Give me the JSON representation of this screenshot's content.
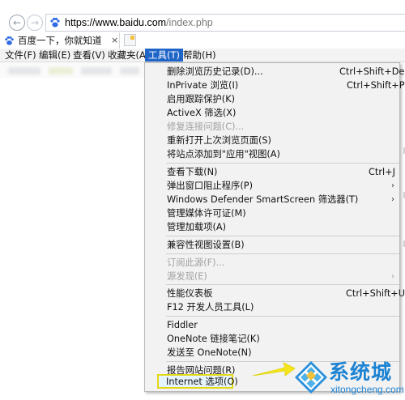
{
  "address_bar": {
    "url_main": "https://www.baidu.com",
    "url_path": "/index.php"
  },
  "tab": {
    "title": "百度一下，你就知道",
    "close_glyph": "×"
  },
  "menu_bar": {
    "items": [
      "文件(F)",
      "编辑(E)",
      "查看(V)",
      "收藏夹(A)",
      "工具(T)",
      "帮助(H)"
    ],
    "active_item": "工具(T)"
  },
  "tools_menu": {
    "items": [
      {
        "label": "删除浏览历史记录(D)...",
        "shortcut": "Ctrl+Shift+Del"
      },
      {
        "label": "InPrivate 浏览(I)",
        "shortcut": "Ctrl+Shift+P"
      },
      {
        "label": "启用跟踪保护(K)",
        "shortcut": ""
      },
      {
        "label": "ActiveX 筛选(X)",
        "shortcut": ""
      },
      {
        "label": "修复连接问题(C)...",
        "shortcut": "",
        "disabled": true
      },
      {
        "label": "重新打开上次浏览页面(S)",
        "shortcut": ""
      },
      {
        "label": "将站点添加到\"应用\"视图(A)",
        "shortcut": ""
      },
      {
        "label": "查看下载(N)",
        "shortcut": "Ctrl+J"
      },
      {
        "label": "弹出窗口阻止程序(P)",
        "shortcut": "",
        "submenu": true
      },
      {
        "label": "Windows Defender SmartScreen 筛选器(T)",
        "shortcut": "",
        "submenu": true
      },
      {
        "label": "管理媒体许可证(M)",
        "shortcut": ""
      },
      {
        "label": "管理加载项(A)",
        "shortcut": ""
      },
      {
        "label": "兼容性视图设置(B)",
        "shortcut": ""
      },
      {
        "label": "订阅此源(F)...",
        "shortcut": "",
        "disabled": true
      },
      {
        "label": "源发现(E)",
        "shortcut": "",
        "disabled": true,
        "submenu": true
      },
      {
        "label": "性能仪表板",
        "shortcut": "Ctrl+Shift+U"
      },
      {
        "label": "F12 开发人员工具(L)",
        "shortcut": ""
      },
      {
        "label": "Fiddler",
        "shortcut": ""
      },
      {
        "label": "OneNote 链接笔记(K)",
        "shortcut": ""
      },
      {
        "label": "发送至 OneNote(N)",
        "shortcut": ""
      },
      {
        "label": "报告网站问题(R)",
        "shortcut": ""
      },
      {
        "label": "Internet 选项(O)",
        "shortcut": "",
        "highlighted": true
      }
    ],
    "submenu_glyph": "›"
  },
  "watermark": {
    "title": "系统城",
    "subtitle": "xitongcheng.com"
  },
  "colors": {
    "menu_active_bg": "#1f64c7",
    "highlight_border": "#e3d81a",
    "watermark_blue": "#1d83d3"
  },
  "icons": {
    "back": "back-arrow-icon",
    "forward": "forward-arrow-icon",
    "site": "baidu-paw-icon",
    "new_tab": "new-tab-icon"
  }
}
